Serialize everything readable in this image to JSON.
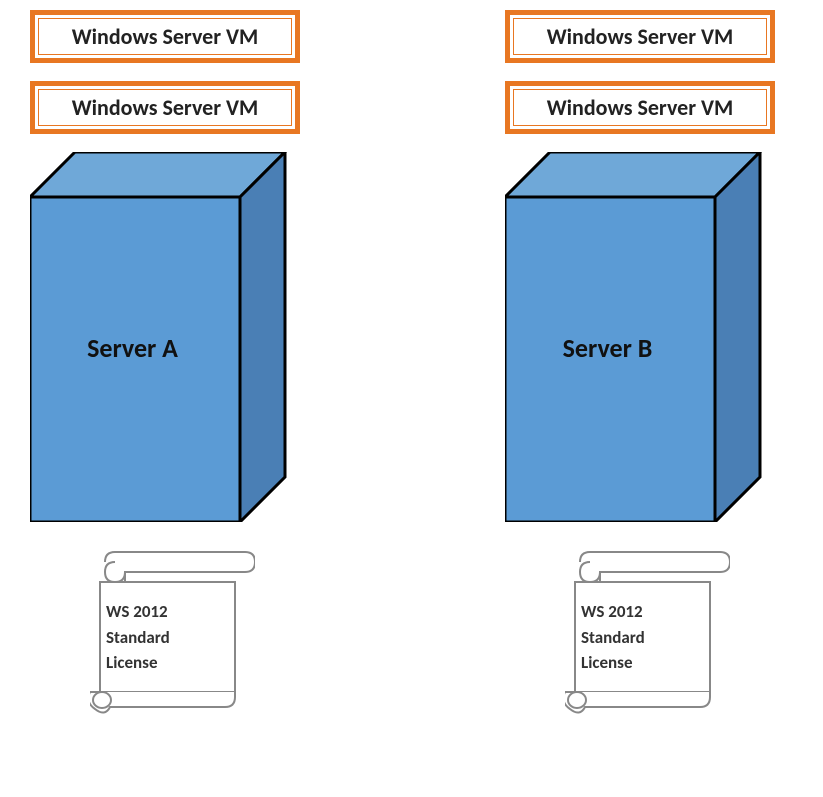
{
  "serverA": {
    "vm1": "Windows Server VM",
    "vm2": "Windows Server VM",
    "name": "Server A",
    "license_line1": "WS 2012",
    "license_line2": "Standard",
    "license_line3": "License"
  },
  "serverB": {
    "vm1": "Windows Server VM",
    "vm2": "Windows Server VM",
    "name": "Server B",
    "license_line1": "WS 2012",
    "license_line2": "Standard",
    "license_line3": "License"
  }
}
